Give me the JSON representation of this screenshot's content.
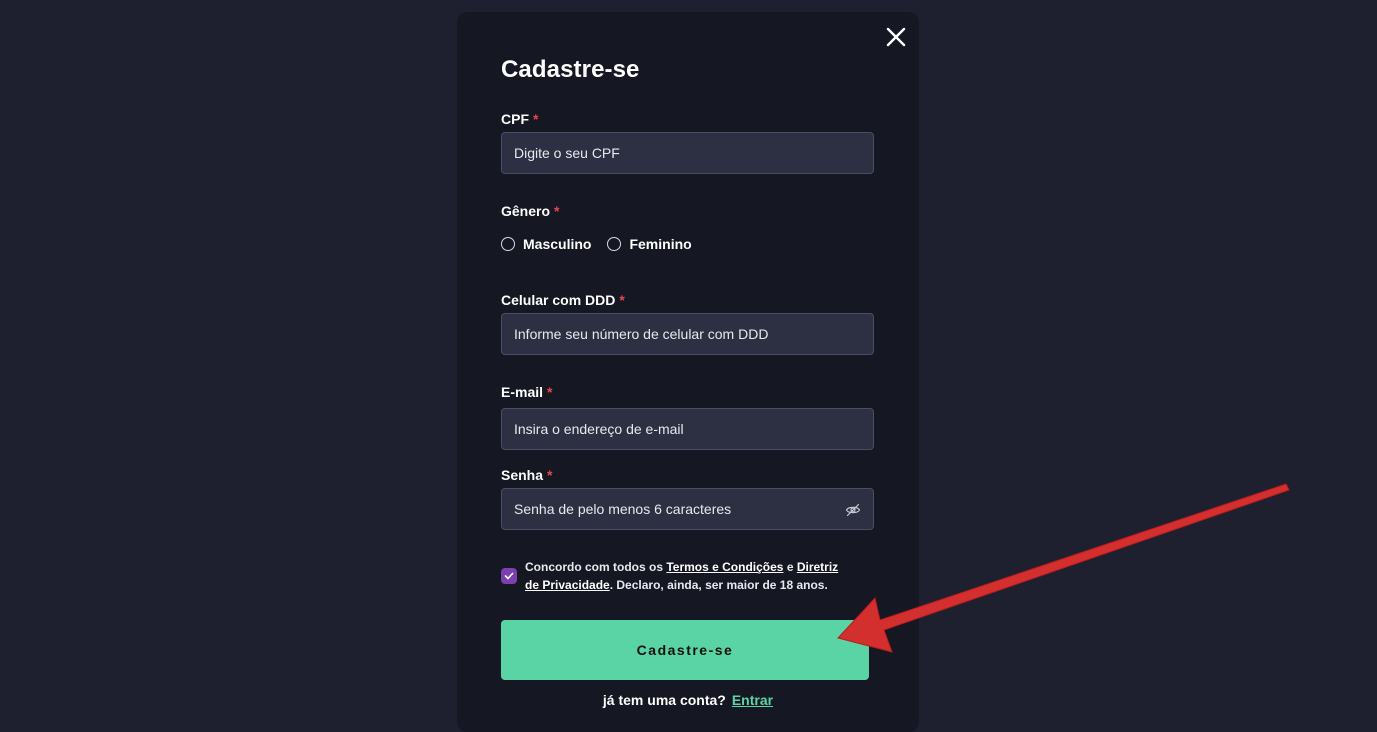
{
  "modal": {
    "title": "Cadastre-se",
    "close_icon": "close-icon"
  },
  "form": {
    "cpf": {
      "label": "CPF",
      "required": "*",
      "placeholder": "Digite o seu CPF"
    },
    "gender": {
      "label": "Gênero",
      "required": "*",
      "options": [
        "Masculino",
        "Feminino"
      ]
    },
    "phone": {
      "label": "Celular com DDD",
      "required": "*",
      "placeholder": "Informe seu número de celular com DDD"
    },
    "email": {
      "label": "E-mail",
      "required": "*",
      "placeholder": "Insira o endereço de e-mail"
    },
    "password": {
      "label": "Senha",
      "required": "*",
      "placeholder": "Senha de pelo menos 6 caracteres",
      "toggle_icon": "eye-off-icon"
    }
  },
  "consent": {
    "checked": true,
    "text_before": "Concordo com todos os ",
    "terms_link": "Termos e Condições",
    "text_and": " e ",
    "privacy_link": "Diretriz de Privacidade",
    "text_after": ". Declaro, ainda, ser maior de 18 anos."
  },
  "submit": {
    "label": "Cadastre-se"
  },
  "login": {
    "prompt": "já tem uma conta?",
    "link": "Entrar"
  },
  "colors": {
    "background": "#1e2030",
    "modal": "#151722",
    "accent": "#5ad3a5",
    "checkbox": "#7b3fb1",
    "required": "#e5484d",
    "annotation_arrow": "#d32f2f"
  }
}
